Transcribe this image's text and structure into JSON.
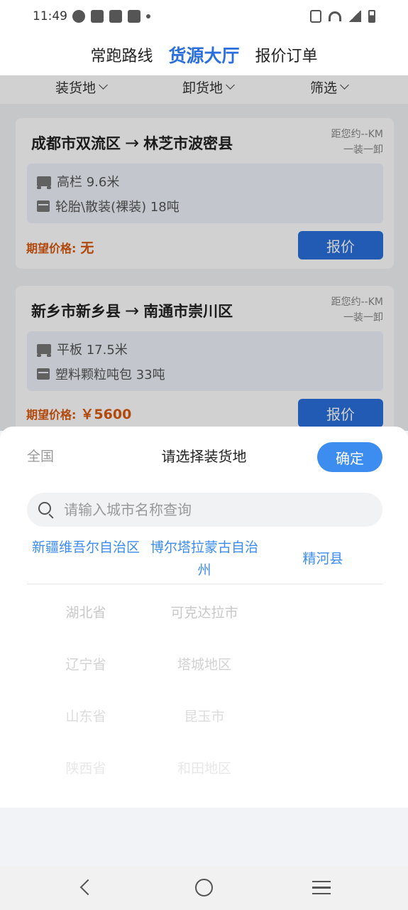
{
  "status_bar": {
    "time": "11:49"
  },
  "tabs": [
    {
      "label": "常跑路线",
      "active": false
    },
    {
      "label": "货源大厅",
      "active": true
    },
    {
      "label": "报价订单",
      "active": false
    }
  ],
  "filters": [
    {
      "label": "装货地"
    },
    {
      "label": "卸货地"
    },
    {
      "label": "筛选"
    }
  ],
  "cards": [
    {
      "origin": "成都市双流区",
      "arrow": "→",
      "destination": "林芝市波密县",
      "distance": "距您约--KM",
      "load_type": "一装一卸",
      "vehicle": "高栏  9.6米",
      "cargo": "轮胎\\散装(裸装)  18吨",
      "price_label": "期望价格:",
      "price": "无",
      "quote_label": "报价"
    },
    {
      "origin": "新乡市新乡县",
      "arrow": "→",
      "destination": "南通市崇川区",
      "distance": "距您约--KM",
      "load_type": "一装一卸",
      "vehicle": "平板  17.5米",
      "cargo": "塑料颗粒吨包  33吨",
      "price_label": "期望价格:",
      "price": "￥5600",
      "quote_label": "报价"
    }
  ],
  "sheet": {
    "left_label": "全国",
    "title": "请选择装货地",
    "confirm_label": "确定",
    "search_placeholder": "请输入城市名称查询",
    "selected": {
      "province": "新疆维吾尔自治区",
      "prefecture": "博尔塔拉蒙古自治州",
      "county": "精河县"
    },
    "province_options": [
      "湖北省",
      "辽宁省",
      "山东省",
      "陕西省"
    ],
    "city_options": [
      "可克达拉市",
      "塔城地区",
      "昆玉市",
      "和田地区"
    ]
  },
  "colors": {
    "accent": "#2a6fdb",
    "confirm": "#3d8cf0",
    "price": "#d9590f"
  }
}
